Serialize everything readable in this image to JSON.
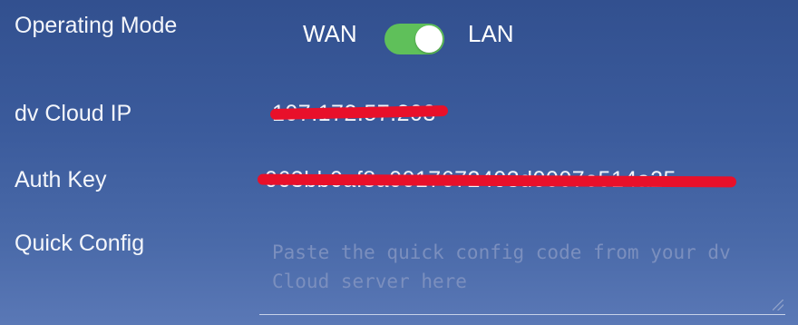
{
  "operating_mode": {
    "label": "Operating Mode",
    "left_option": "WAN",
    "right_option": "LAN",
    "toggle_on": true,
    "toggle_color": "#5fc05a"
  },
  "cloud_ip": {
    "label": "dv Cloud IP",
    "value": "107.172.57.203",
    "redacted": true
  },
  "auth_key": {
    "label": "Auth Key",
    "value": "063bb0af8a0017672403d0007e514a25",
    "redacted": true
  },
  "quick_config": {
    "label": "Quick Config",
    "value": "",
    "placeholder": "Paste the quick config code from your dv Cloud server here"
  },
  "colors": {
    "background": "#3b5b9c",
    "redaction": "#e8102a"
  }
}
